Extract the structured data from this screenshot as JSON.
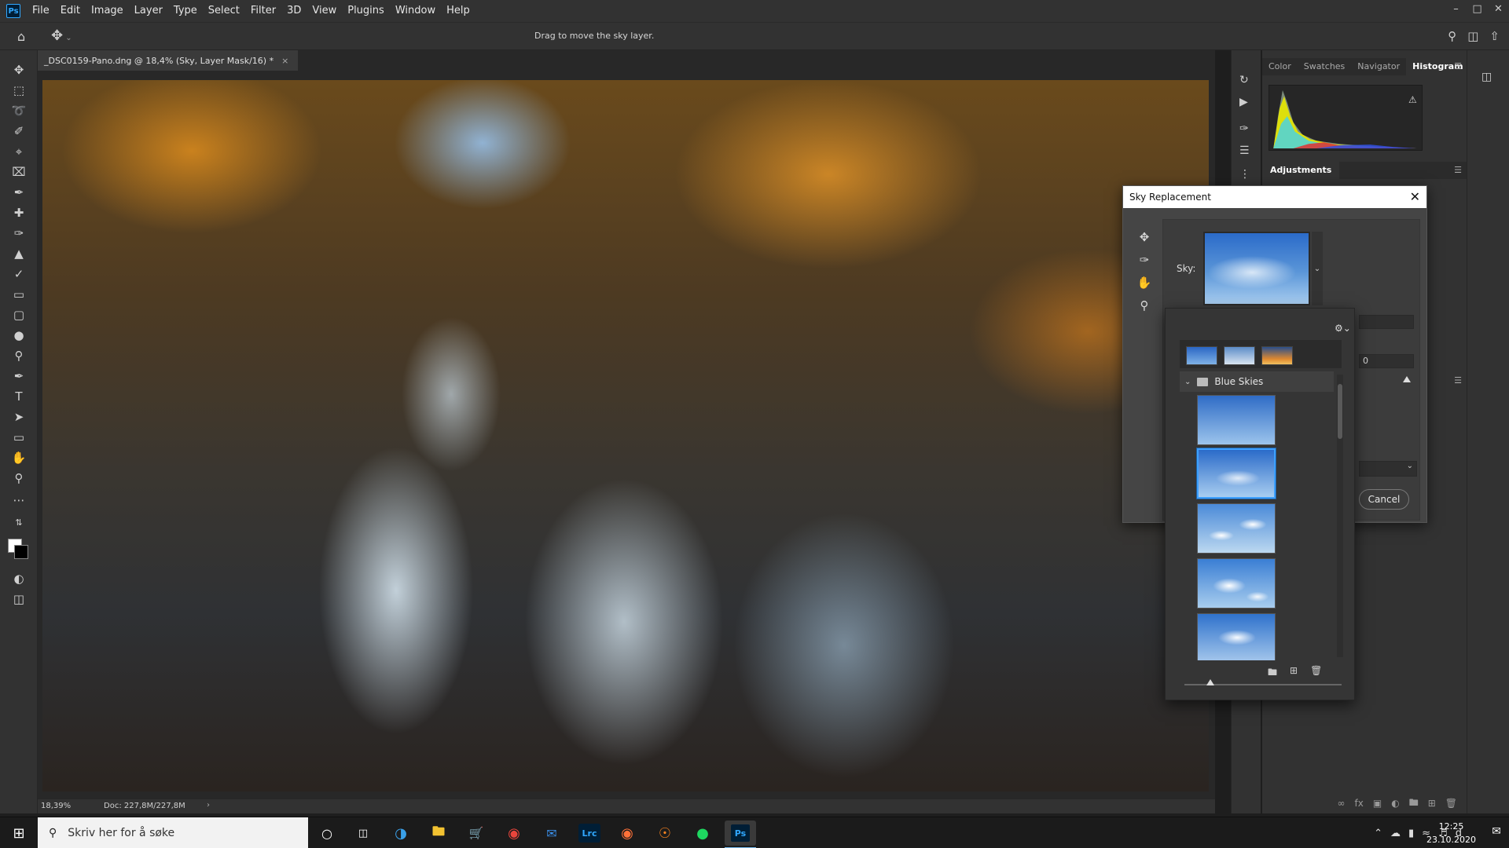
{
  "app": {
    "logo": "Ps",
    "menu": [
      "File",
      "Edit",
      "Image",
      "Layer",
      "Type",
      "Select",
      "Filter",
      "3D",
      "View",
      "Plugins",
      "Window",
      "Help"
    ],
    "window_controls": [
      "minimize-icon",
      "maximize-icon",
      "close-icon"
    ]
  },
  "options_bar": {
    "hint": "Drag to move the sky layer."
  },
  "document": {
    "tab_title": "_DSC0159-Pano.dng @ 18,4% (Sky, Layer Mask/16) *",
    "tab_close": "×"
  },
  "status_bar": {
    "zoom": "18,39%",
    "doc_size": "Doc: 227,8M/227,8M"
  },
  "right_panel": {
    "tabs": [
      "Color",
      "Swatches",
      "Navigator",
      "Histogram"
    ],
    "active_tab": "Histogram",
    "adjustments_title": "Adjustments"
  },
  "dialog": {
    "title": "Sky Replacement",
    "sky_label": "Sky:",
    "field_value": "0",
    "cancel_label": "Cancel"
  },
  "sky_picker": {
    "group_name": "Blue Skies",
    "recent_count": 3,
    "thumb_count": 5,
    "selected_index": 1
  },
  "taskbar": {
    "search_placeholder": "Skriv her for å søke",
    "apps": [
      "Cortana",
      "Task View",
      "Edge",
      "File Explorer",
      "Store",
      "Chrome",
      "Mail",
      "Lrc",
      "Firefox",
      "Origin",
      "Spotify",
      "Ps"
    ],
    "time": "12:25",
    "date": "23.10.2020"
  },
  "colors": {
    "accent_blue": "#3ea0ff",
    "ps_blue": "#31a8ff",
    "panel_bg": "#323232",
    "dialog_bg": "#454545"
  }
}
